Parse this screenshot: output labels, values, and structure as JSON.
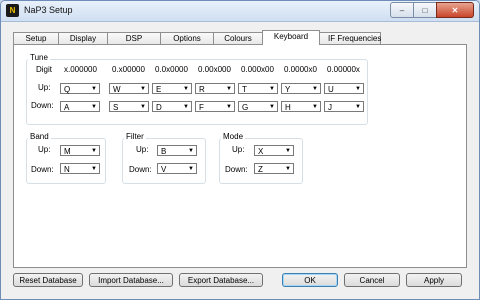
{
  "window": {
    "title": "NaP3 Setup",
    "icon_letter": "N"
  },
  "caption_buttons": {
    "minimize": "–",
    "maximize": "□",
    "close": "✕"
  },
  "tabs": [
    {
      "label": "Setup"
    },
    {
      "label": "Display"
    },
    {
      "label": "DSP"
    },
    {
      "label": "Options"
    },
    {
      "label": "Colours"
    },
    {
      "label": "Keyboard",
      "active": true
    },
    {
      "label": "IF Frequencies"
    }
  ],
  "tune": {
    "title": "Tune",
    "digit_label": "Digit",
    "digits": [
      "x.000000",
      "0.x00000",
      "0.0x0000",
      "0.00x000",
      "0.000x00",
      "0.0000x0",
      "0.00000x"
    ],
    "up_label": "Up:",
    "down_label": "Down:",
    "up": [
      "Q",
      "W",
      "E",
      "R",
      "T",
      "Y",
      "U"
    ],
    "down": [
      "A",
      "S",
      "D",
      "F",
      "G",
      "H",
      "J"
    ]
  },
  "band": {
    "title": "Band",
    "up_label": "Up:",
    "down_label": "Down:",
    "up": "M",
    "down": "N"
  },
  "filter": {
    "title": "Filter",
    "up_label": "Up:",
    "down_label": "Down:",
    "up": "B",
    "down": "V"
  },
  "mode": {
    "title": "Mode",
    "up_label": "Up:",
    "down_label": "Down:",
    "up": "X",
    "down": "Z"
  },
  "buttons": {
    "reset": "Reset Database",
    "import": "Import Database...",
    "export": "Export Database...",
    "ok": "OK",
    "cancel": "Cancel",
    "apply": "Apply"
  },
  "icons": {
    "combo_arrow": "chevron-down-icon"
  }
}
